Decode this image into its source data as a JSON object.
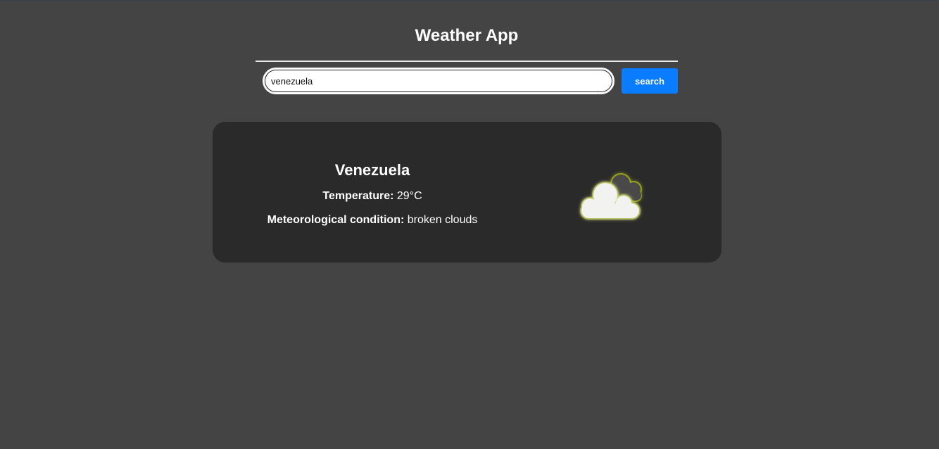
{
  "app": {
    "title": "Weather App"
  },
  "search": {
    "value": "venezuela",
    "button_label": "search"
  },
  "result": {
    "city": "Venezuela",
    "temperature_label": "Temperature:",
    "temperature_value": "29°C",
    "condition_label": "Meteorological condition:",
    "condition_value": "broken clouds",
    "icon": "broken-clouds-icon"
  },
  "colors": {
    "background": "#444444",
    "card": "#2a2a2a",
    "button": "#0a7cff",
    "cloud_front": "#f2f2f0",
    "cloud_back": "#4a4a4a",
    "cloud_glow": "#c8d400"
  }
}
